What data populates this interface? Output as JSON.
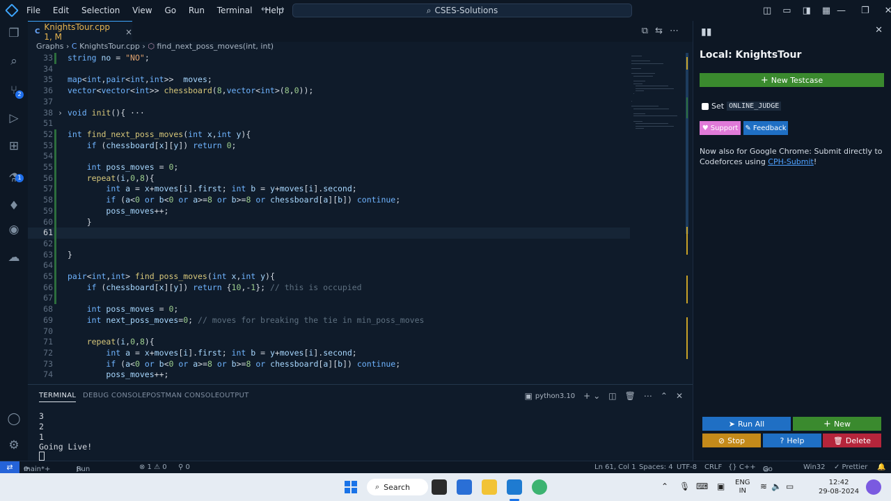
{
  "menu": [
    "File",
    "Edit",
    "Selection",
    "View",
    "Go",
    "Run",
    "Terminal",
    "Help"
  ],
  "search": {
    "label": "CSES-Solutions"
  },
  "tab": {
    "name": "KnightsTour.cpp",
    "status": "1, M",
    "close": "×",
    "lang": "C"
  },
  "breadcrumb": {
    "folder": "Graphs",
    "file": "KnightsTour.cpp",
    "symbol": "find_next_poss_moves(int, int)"
  },
  "badges": {
    "source_control": "2",
    "extensions": "1"
  },
  "code_lines": [
    {
      "n": "33",
      "t": "string no = \"NO\";"
    },
    {
      "n": "34",
      "t": ""
    },
    {
      "n": "35",
      "t": "map<int,pair<int,int>>  moves;"
    },
    {
      "n": "36",
      "t": "vector<vector<int>> chessboard(8,vector<int>(8,0));"
    },
    {
      "n": "37",
      "t": ""
    },
    {
      "n": "38",
      "t": "void init(){ ···"
    },
    {
      "n": "51",
      "t": ""
    },
    {
      "n": "52",
      "t": "int find_next_poss_moves(int x,int y){"
    },
    {
      "n": "53",
      "t": "    if (chessboard[x][y]) return 0;"
    },
    {
      "n": "54",
      "t": ""
    },
    {
      "n": "55",
      "t": "    int poss_moves = 0;"
    },
    {
      "n": "56",
      "t": "    repeat(i,0,8){"
    },
    {
      "n": "57",
      "t": "        int a = x+moves[i].first; int b = y+moves[i].second;"
    },
    {
      "n": "58",
      "t": "        if (a<0 or b<0 or a>=8 or b>=8 or chessboard[a][b]) continue;"
    },
    {
      "n": "59",
      "t": "        poss_moves++;"
    },
    {
      "n": "60",
      "t": "    }"
    },
    {
      "n": "61",
      "t": ""
    },
    {
      "n": "62",
      "t": ""
    },
    {
      "n": "63",
      "t": "}"
    },
    {
      "n": "64",
      "t": ""
    },
    {
      "n": "65",
      "t": "pair<int,int> find_poss_moves(int x,int y){"
    },
    {
      "n": "66",
      "t": "    if (chessboard[x][y]) return {10,-1}; // this is occupied"
    },
    {
      "n": "67",
      "t": ""
    },
    {
      "n": "68",
      "t": "    int poss_moves = 0;"
    },
    {
      "n": "69",
      "t": "    int next_poss_moves=0; // moves for breaking the tie in min_poss_moves"
    },
    {
      "n": "70",
      "t": ""
    },
    {
      "n": "71",
      "t": "    repeat(i,0,8){"
    },
    {
      "n": "72",
      "t": "        int a = x+moves[i].first; int b = y+moves[i].second;"
    },
    {
      "n": "73",
      "t": "        if (a<0 or b<0 or a>=8 or b>=8 or chessboard[a][b]) continue;"
    },
    {
      "n": "74",
      "t": "        poss_moves++;"
    }
  ],
  "panel": {
    "tabs": [
      "TERMINAL",
      "DEBUG CONSOLE",
      "POSTMAN CONSOLE",
      "OUTPUT"
    ],
    "shell": "python3.10",
    "output": [
      "3",
      "2",
      "1",
      "Going Live!"
    ]
  },
  "side": {
    "title": "Local: KnightsTour",
    "new_testcase": "New Testcase",
    "set_label": "Set",
    "online_judge": "ONLINE_JUDGE",
    "support": "Support",
    "feedback": "Feedback",
    "promo_text": "Now also for Google Chrome: Submit directly to Codeforces using ",
    "promo_link": "CPH-Submit",
    "promo_end": "!",
    "run_all": "Run All",
    "new": "New",
    "stop": "Stop",
    "help": "Help",
    "delete": "Delete"
  },
  "status": {
    "branch": "main*+",
    "run_testcases": "Run Testcases",
    "problems": "⊗ 1 ⚠ 0",
    "ports": "⚲ 0",
    "position": "Ln 61, Col 1",
    "spaces": "Spaces: 4",
    "encoding": "UTF-8",
    "eol": "CRLF",
    "language": "{} C++",
    "golive": "Go Live",
    "platform": "Win32",
    "prettier": "✓ Prettier"
  },
  "taskbar": {
    "search": "Search",
    "lang_line1": "ENG",
    "lang_line2": "IN",
    "time": "12:42",
    "date": "29-08-2024"
  },
  "colors": {
    "accent": "#3ea6ff",
    "new_testcase": "#3a8a2e",
    "run_all": "#1f6fc4",
    "stop": "#c48a1a",
    "help": "#1f6fc4",
    "delete": "#b5253b",
    "support": "#e07ad8",
    "feedback": "#1f6fc4"
  }
}
